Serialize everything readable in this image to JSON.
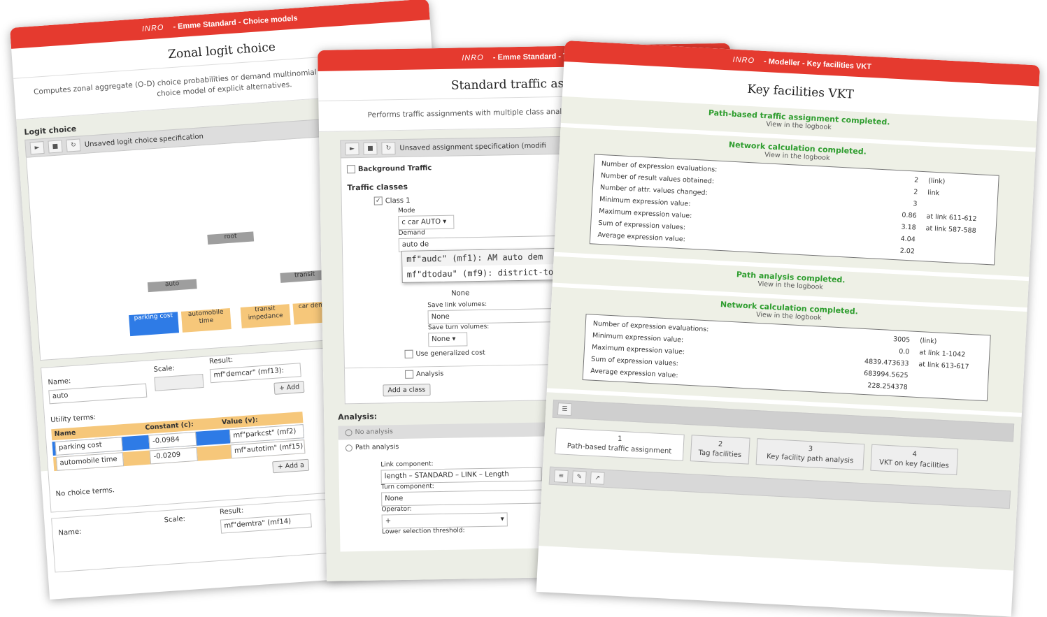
{
  "colors": {
    "titlebar": "#e53a2f",
    "success": "#2e9d2e",
    "selected_node": "#2e7be6",
    "util_node": "#f6c77a",
    "header_node": "#9e9e9e"
  },
  "win1": {
    "logo": "INRO",
    "title": "- Emme Standard - Choice models",
    "page_title": "Zonal logit choice",
    "desc": "Computes zonal aggregate (O-D) choice probabilities or demand multinomial (MNL) or nested logit (NL) choice model of explicit alternatives.",
    "section": "Logit choice",
    "spec_label": "Unsaved logit choice specification",
    "tree": {
      "root": "root",
      "auto": "auto",
      "transit": "transit",
      "leaf1": "parking cost",
      "leaf2": "automobile time",
      "leaf3": "transit impedance",
      "leaf4": "car demand"
    },
    "form": {
      "name_label": "Name:",
      "name_value": "auto",
      "scale_label": "Scale:",
      "result_label": "Result:",
      "result_value": "mf\"demcar\" (mf13):",
      "add_label": "+ Add",
      "utility_label": "Utility terms:",
      "headers": [
        "Name",
        "Constant (c):",
        "Value (v):"
      ],
      "rows": [
        [
          "parking cost",
          "-0.0984",
          "mf\"parkcst\" (mf2)"
        ],
        [
          "automobile time",
          "-0.0209",
          "mf\"autotim\" (mf15)"
        ]
      ],
      "add_a_label": "+ Add a",
      "no_choice": "No choice terms.",
      "name2_label": "Name:",
      "scale2_label": "Scale:",
      "result2_label": "Result:",
      "result2_value": "mf\"demtra\" (mf14)"
    }
  },
  "win2": {
    "logo": "INRO",
    "title": "- Emme Standard - Traffic",
    "page_title": "Standard traffic assig",
    "desc": "Performs traffic assignments with multiple class analysis.",
    "spec_label": "Unsaved assignment specification (modifi",
    "background": "Background Traffic",
    "traffic_classes": "Traffic classes",
    "class1": "Class 1",
    "mode_label": "Mode",
    "mode_value": "c car AUTO",
    "demand_label": "Demand",
    "demand_value": "auto de",
    "suggest1": "mf\"audc\" (mf1): AM auto dem",
    "suggest1_bold": "auto dem",
    "suggest2": "mf\"dtodau\" (mf9): district-to-d",
    "none1": "None",
    "save_link_label": "Save link volumes:",
    "save_link_value": "None",
    "save_turn_label": "Save turn volumes:",
    "save_turn_value": "None",
    "gen_cost": "Use generalized cost",
    "analysis_chk": "Analysis",
    "add_class": "Add a class",
    "analysis_title": "Analysis:",
    "no_analysis": "No analysis",
    "path_analysis": "Path analysis",
    "link_comp_label": "Link component:",
    "link_comp_value": "length – STANDARD – LINK – Length",
    "turn_comp_label": "Turn component:",
    "turn_comp_value": "None",
    "operator_label": "Operator:",
    "operator_value": "+",
    "threshold_label": "Lower selection threshold:"
  },
  "win3": {
    "logo": "INRO",
    "title": "- Modeller - Key facilities VKT",
    "page_title": "Key facilities VKT",
    "box1": {
      "ok": "Path-based traffic assignment completed.",
      "sub": "View in the logbook"
    },
    "box2": {
      "ok": "Network calculation completed.",
      "sub": "View in the logbook"
    },
    "stats1": [
      [
        "Number of expression evaluations:",
        "2",
        "(link)"
      ],
      [
        "Number of result values obtained:",
        "2",
        "link"
      ],
      [
        "Number of attr. values changed:",
        "3",
        ""
      ],
      [
        "Minimum expression value:",
        "0.86",
        "at link 611-612"
      ],
      [
        "Maximum expression value:",
        "3.18",
        "at link 587-588"
      ],
      [
        "Sum of expression values:",
        "4.04",
        ""
      ],
      [
        "Average expression value:",
        "2.02",
        ""
      ]
    ],
    "box3": {
      "ok": "Path analysis completed.",
      "sub": "View in the logbook"
    },
    "box4": {
      "ok": "Network calculation completed.",
      "sub": "View in the logbook"
    },
    "stats2": [
      [
        "Number of expression evaluations:",
        "3005",
        "(link)"
      ],
      [
        "Minimum expression value:",
        "0.0",
        "at link 1-1042"
      ],
      [
        "Maximum expression value:",
        "4839.473633",
        "at link 613-617"
      ],
      [
        "Sum of expression values:",
        "683994.5625",
        ""
      ],
      [
        "Average expression value:",
        "228.254378",
        ""
      ]
    ],
    "steps": [
      {
        "n": "1",
        "label": "Path-based traffic assignment"
      },
      {
        "n": "2",
        "label": "Tag facilities"
      },
      {
        "n": "3",
        "label": "Key facility path analysis"
      },
      {
        "n": "4",
        "label": "VKT on key facilities"
      }
    ]
  }
}
